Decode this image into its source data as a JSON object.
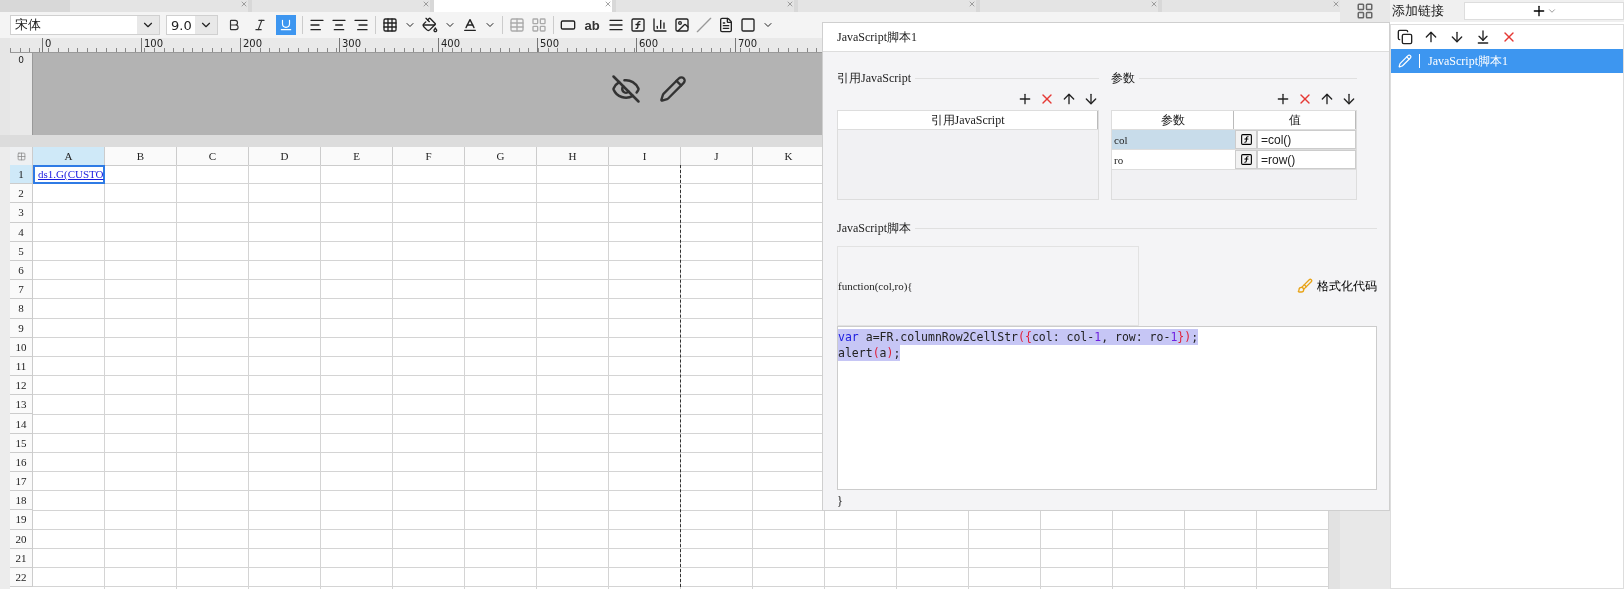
{
  "tabs": [
    {
      "selected": false
    },
    {
      "selected": false
    },
    {
      "selected": true
    },
    {
      "selected": false
    },
    {
      "selected": false
    },
    {
      "selected": false
    },
    {
      "selected": false
    }
  ],
  "toolbar": {
    "font": "宋体",
    "size": "9.0",
    "bold": false,
    "italic": false,
    "underline": true,
    "ab_label": "ab"
  },
  "ruler": {
    "labels": [
      "0",
      "100",
      "200",
      "300",
      "400",
      "500",
      "600",
      "700"
    ],
    "vertical_label": "0"
  },
  "sheet": {
    "columns": [
      {
        "label": "A",
        "selected": true
      },
      {
        "label": "B",
        "selected": false
      },
      {
        "label": "C",
        "selected": false
      },
      {
        "label": "D",
        "selected": false
      },
      {
        "label": "E",
        "selected": false
      },
      {
        "label": "F",
        "selected": false
      },
      {
        "label": "G",
        "selected": false
      },
      {
        "label": "H",
        "selected": false
      },
      {
        "label": "I",
        "selected": false
      },
      {
        "label": "J",
        "selected": false
      },
      {
        "label": "K",
        "selected": false
      }
    ],
    "rows": [
      {
        "label": "1",
        "selected": true
      },
      {
        "label": "2",
        "selected": false
      },
      {
        "label": "3",
        "selected": false
      },
      {
        "label": "4",
        "selected": false
      },
      {
        "label": "5",
        "selected": false
      },
      {
        "label": "6",
        "selected": false
      },
      {
        "label": "7",
        "selected": false
      },
      {
        "label": "8",
        "selected": false
      },
      {
        "label": "9",
        "selected": false
      },
      {
        "label": "10",
        "selected": false
      },
      {
        "label": "11",
        "selected": false
      },
      {
        "label": "12",
        "selected": false
      },
      {
        "label": "13",
        "selected": false
      },
      {
        "label": "14",
        "selected": false
      },
      {
        "label": "15",
        "selected": false
      },
      {
        "label": "16",
        "selected": false
      },
      {
        "label": "17",
        "selected": false
      },
      {
        "label": "18",
        "selected": false
      },
      {
        "label": "19",
        "selected": false
      },
      {
        "label": "20",
        "selected": false
      },
      {
        "label": "21",
        "selected": false
      },
      {
        "label": "22",
        "selected": false
      }
    ],
    "cell_a1": "ds1.G(CUSTO"
  },
  "dialog": {
    "title": "JavaScript脚本1",
    "imports": {
      "heading": "引用JavaScript",
      "column": "引用JavaScript"
    },
    "params": {
      "heading": "参数",
      "columns": [
        "参数",
        "值"
      ],
      "rows": [
        {
          "name": "col",
          "value": "=col()",
          "selected": true
        },
        {
          "name": "ro",
          "value": "=row()",
          "selected": false
        }
      ]
    },
    "script": {
      "heading": "JavaScript脚本",
      "signature": "function(col,ro){",
      "format_button": "格式化代码",
      "closing": "}",
      "lines": [
        [
          {
            "text": "var",
            "kind": "keyword"
          },
          {
            "text": " a=FR.columnRow2CellStr",
            "kind": "plain"
          },
          {
            "text": "({",
            "kind": "bracket"
          },
          {
            "text": "col: col-",
            "kind": "plain"
          },
          {
            "text": "1",
            "kind": "number"
          },
          {
            "text": ", row: ro-",
            "kind": "plain"
          },
          {
            "text": "1",
            "kind": "number"
          },
          {
            "text": "})",
            "kind": "bracket"
          },
          {
            "text": ";",
            "kind": "plain"
          }
        ],
        [
          {
            "text": "alert",
            "kind": "plain"
          },
          {
            "text": "(",
            "kind": "bracket"
          },
          {
            "text": "a",
            "kind": "plain"
          },
          {
            "text": ")",
            "kind": "bracket"
          },
          {
            "text": ";",
            "kind": "plain"
          }
        ]
      ]
    }
  },
  "links": {
    "title": "添加链接",
    "items": [
      {
        "label": "JavaScript脚本1",
        "selected": true
      }
    ]
  }
}
